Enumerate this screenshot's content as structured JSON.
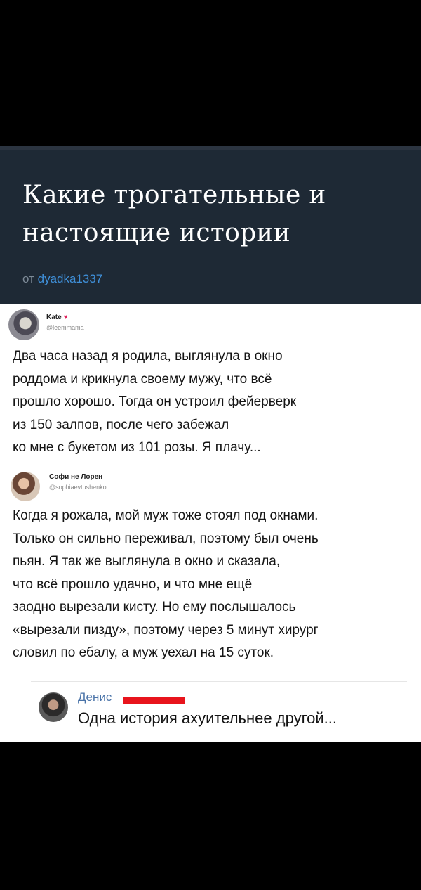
{
  "article": {
    "title": "Какие трогательные и настоящие истории",
    "by_prefix": "от",
    "author": "dyadka1337"
  },
  "tweets": [
    {
      "name": "Kate",
      "heart": "♥",
      "handle": "@leemmama",
      "text": "Два часа назад я родила, выглянула в окно\nроддома и крикнула своему мужу, что всё\nпрошло хорошо. Тогда он устроил фейерверк\nиз 150 залпов, после чего забежал\nко мне с букетом из 101 розы. Я плачу..."
    },
    {
      "name": "Софи не Лорен",
      "handle": "@sophiaevtushenko",
      "text": "Когда я рожала, мой муж тоже стоял под окнами.\nТолько он сильно переживал, поэтому был очень\nпьян. Я так же выглянула в окно и сказала,\nчто всё прошло удачно, и что мне ещё\nзаодно вырезали кисту. Но ему послышалось\n«вырезали пизду», поэтому через 5 минут хирург\nсловил по ебалу, а муж уехал на 15 суток."
    }
  ],
  "comment": {
    "name": "Денис",
    "redaction_color": "#e8141c",
    "text": "Одна история ахуительнее другой..."
  },
  "colors": {
    "header_bg": "#1e2935",
    "author_link": "#3f8fd8",
    "comment_name": "#4a73a8"
  }
}
